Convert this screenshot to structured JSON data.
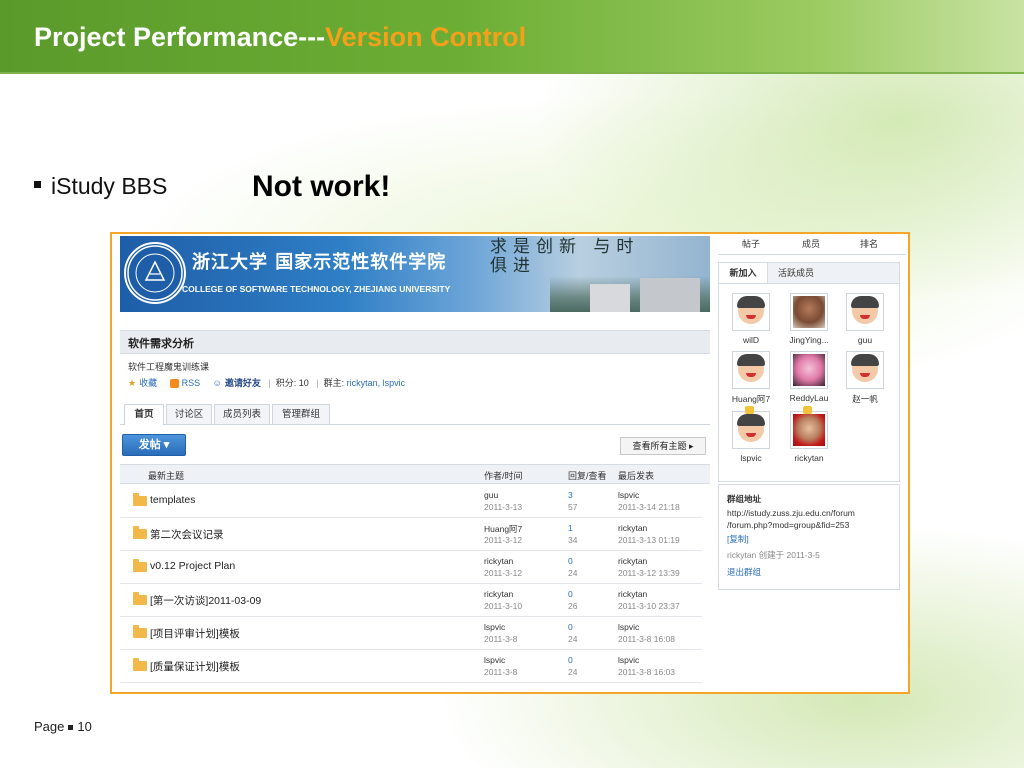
{
  "slide": {
    "title_main": "Project Performance---",
    "title_accent": "Version Control",
    "bullet": "iStudy BBS",
    "note": "Not work!",
    "footer_label": "Page",
    "page_number": "10",
    "accent_color": "#f6a01a",
    "frame_color": "#f4a62a"
  },
  "banner": {
    "cn_title": "浙江大学 国家示范性软件学院",
    "en_title": "COLLEGE OF SOFTWARE TECHNOLOGY, ZHEJIANG UNIVERSITY",
    "motto": "求是创新 与时俱进"
  },
  "group": {
    "name": "软件需求分析",
    "subtitle": "软件工程魔鬼训练课",
    "favorite": "收藏",
    "rss": "RSS",
    "invite": "邀请好友",
    "points": "积分: 10",
    "owner_label": "群主:",
    "owners": "rickytan, lspvic"
  },
  "tabs": [
    "首页",
    "讨论区",
    "成员列表",
    "管理群组"
  ],
  "actions": {
    "post": "发帖 ▾",
    "view_all": "查看所有主题 ▸"
  },
  "table": {
    "headers": [
      "最新主题",
      "作者/时间",
      "回复/查看",
      "最后发表"
    ],
    "rows": [
      {
        "topic": "templates",
        "author": "guu",
        "date": "2011-3-13",
        "replies": "3",
        "views": "57",
        "last_user": "lspvic",
        "last_time": "2011-3-14 21:18"
      },
      {
        "topic": "第二次会议记录",
        "author": "Huang阿7",
        "date": "2011-3-12",
        "replies": "1",
        "views": "34",
        "last_user": "rickytan",
        "last_time": "2011-3-13 01:19"
      },
      {
        "topic": "v0.12 Project Plan",
        "author": "rickytan",
        "date": "2011-3-12",
        "replies": "0",
        "views": "24",
        "last_user": "rickytan",
        "last_time": "2011-3-12 13:39"
      },
      {
        "topic": "[第一次访谈]2011-03-09",
        "author": "rickytan",
        "date": "2011-3-10",
        "replies": "0",
        "views": "26",
        "last_user": "rickytan",
        "last_time": "2011-3-10 23:37"
      },
      {
        "topic": "[项目评审计划]模板",
        "author": "lspvic",
        "date": "2011-3-8",
        "replies": "0",
        "views": "24",
        "last_user": "lspvic",
        "last_time": "2011-3-8 16:08"
      },
      {
        "topic": "[质量保证计划]模板",
        "author": "lspvic",
        "date": "2011-3-8",
        "replies": "0",
        "views": "24",
        "last_user": "lspvic",
        "last_time": "2011-3-8 16:03"
      }
    ]
  },
  "sidebar": {
    "top_tabs": [
      "帖子",
      "成员",
      "排名"
    ],
    "member_tabs": [
      "新加入",
      "活跃成员"
    ],
    "members": [
      {
        "name": "wilD",
        "type": "cartoon"
      },
      {
        "name": "JingYing...",
        "type": "photo"
      },
      {
        "name": "guu",
        "type": "cartoon"
      },
      {
        "name": "Huang阿7",
        "type": "cartoon"
      },
      {
        "name": "ReddyLau",
        "type": "pink"
      },
      {
        "name": "赵一帆",
        "type": "cartoon"
      },
      {
        "name": "lspvic",
        "type": "cartoon"
      },
      {
        "name": "rickytan",
        "type": "red"
      }
    ],
    "group_info": {
      "title": "群组地址",
      "url_line1": "http://istudy.zuss.zju.edu.cn/forum",
      "url_line2": "/forum.php?mod=group&fid=253",
      "copy": "[复制]",
      "creator": "rickytan 创建于 2011-3-5",
      "quit": "退出群组"
    }
  }
}
